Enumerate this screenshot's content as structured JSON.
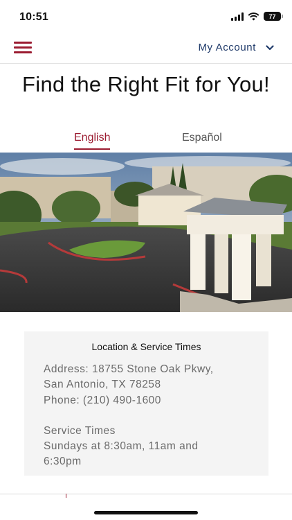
{
  "status_bar": {
    "time": "10:51",
    "battery": "77"
  },
  "nav": {
    "account_label": "My Account"
  },
  "page": {
    "title": "Find the Right Fit for You!"
  },
  "tabs": [
    {
      "label": "English",
      "active": true
    },
    {
      "label": "Español",
      "active": false
    }
  ],
  "info_card": {
    "title": "Location & Service Times",
    "address_line1": "Address: 18755 Stone Oak Pkwy,",
    "address_line2": "San Antonio, TX 78258",
    "phone": "Phone: (210) 490-1600",
    "service_heading": "Service Times",
    "service_line1": "Sundays at 8:30am, 11am and",
    "service_line2": "6:30pm"
  },
  "colors": {
    "accent": "#9b1b30",
    "navy": "#1f3a6a",
    "card_bg": "#f4f4f4"
  },
  "icons": [
    "hamburger-menu-icon",
    "chevron-down-icon",
    "signal-icon",
    "wifi-icon",
    "battery-icon"
  ]
}
